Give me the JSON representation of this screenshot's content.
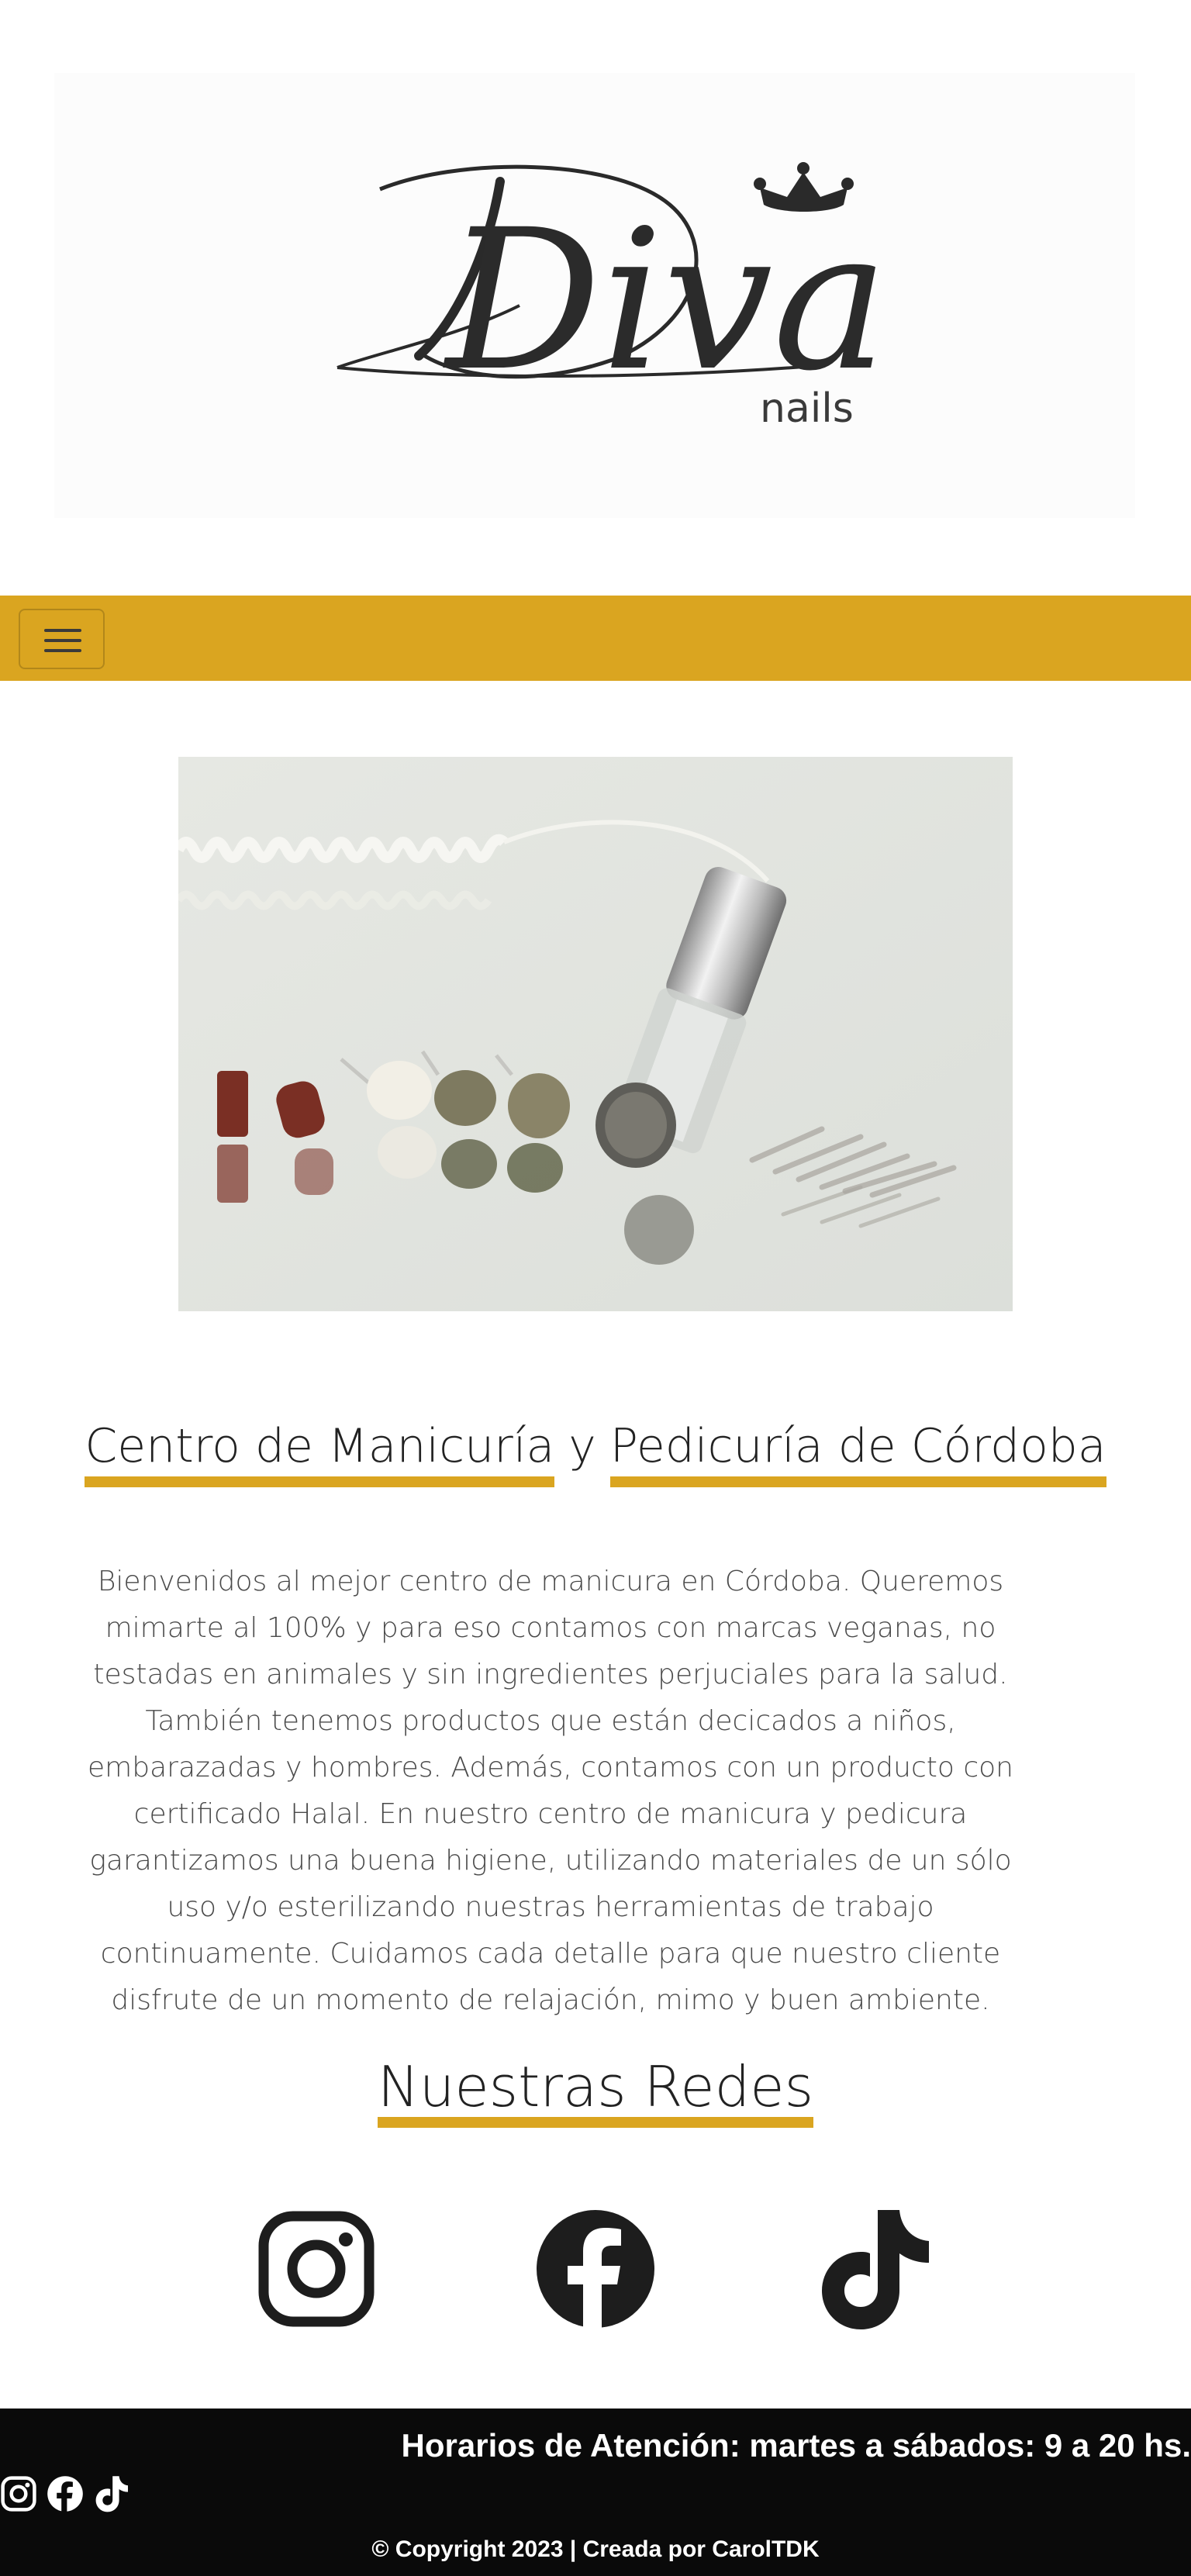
{
  "logo": {
    "brand": "Diva",
    "subbrand": "nails",
    "crown_icon": "crown-icon"
  },
  "navbar": {
    "toggler_icon": "hamburger-menu-icon",
    "color": "#daa520"
  },
  "hero": {
    "alt": "Torno de manicura con fresas"
  },
  "heading": {
    "part1": "Centro de Manicuría",
    "connector": "y",
    "part2": "Pedicuría de Córdoba"
  },
  "description": "Bienvenidos al mejor centro de manicura en Córdoba. Queremos mimarte al 100% y para eso contamos con marcas veganas, no testadas en animales y sin ingredientes perjuciales para la salud. También tenemos productos que están decicados a niños, embarazadas y hombres. Además, contamos con un producto con certificado Halal. En nuestro centro de manicura y pedicura garantizamos una buena higiene, utilizando materiales de un sólo uso y/o esterilizando nuestras herramientas de trabajo continuamente. Cuidamos cada detalle para que nuestro cliente disfrute de un momento de relajación, mimo y buen ambiente.",
  "social_heading": "Nuestras Redes",
  "social": [
    {
      "name": "Instagram",
      "icon": "instagram-icon"
    },
    {
      "name": "Facebook",
      "icon": "facebook-icon"
    },
    {
      "name": "TikTok",
      "icon": "tiktok-icon"
    }
  ],
  "footer": {
    "hours": "Horarios de Atención: martes a sábados: 9 a 20 hs.",
    "copyright": "© Copyright 2023 | Creada por CarolTDK"
  },
  "colors": {
    "accent": "#daa520",
    "footer_bg": "#0a0a0a",
    "text": "#212529"
  }
}
